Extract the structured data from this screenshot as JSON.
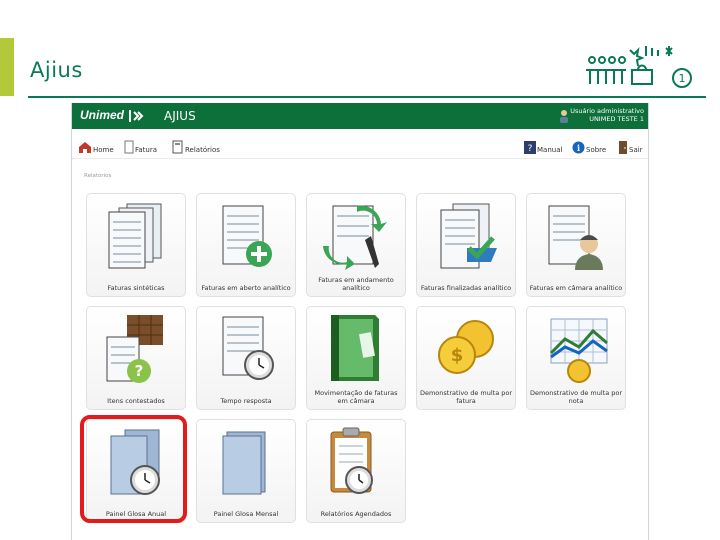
{
  "slide": {
    "title": "Ajius",
    "accent_color": "#b4c93a",
    "brand_color": "#0a7a52",
    "logo_icon": "unimed-people-logo",
    "logo_badge": "1"
  },
  "app": {
    "brand": "Unimed",
    "name": "AJIUS",
    "header_color": "#0d6f3a",
    "user_line1": "Usuário administrativo",
    "user_line2": "UNIMED TESTE 1",
    "toolbar": {
      "home": "Home",
      "fatura": "Fatura",
      "relatorios": "Relatórios",
      "manual": "Manual",
      "sobre": "Sobre",
      "sair": "Sair"
    },
    "breadcrumb": "Relatórios",
    "tiles": [
      {
        "label": "Faturas sintéticas",
        "icon": "documents-stack-icon"
      },
      {
        "label": "Faturas em aberto analítico",
        "icon": "document-add-icon"
      },
      {
        "label": "Faturas em andamento analítico",
        "icon": "document-edit-icon"
      },
      {
        "label": "Faturas finalizadas analítico",
        "icon": "documents-check-icon"
      },
      {
        "label": "Faturas em câmara analítico",
        "icon": "document-person-icon"
      },
      {
        "label": "Itens contestados",
        "icon": "box-question-icon"
      },
      {
        "label": "Tempo resposta",
        "icon": "document-clock-icon"
      },
      {
        "label": "Movimentação de faturas em câmara",
        "icon": "green-binder-icon"
      },
      {
        "label": "Demonstrativo de multa por fatura",
        "icon": "coins-icon"
      },
      {
        "label": "Demonstrativo de multa por nota",
        "icon": "chart-grid-icon"
      },
      {
        "label": "Painel Glosa Anual",
        "icon": "documents-clock-icon"
      },
      {
        "label": "Painel Glosa Mensal",
        "icon": "document-blue-icon"
      },
      {
        "label": "Relatórios Agendados",
        "icon": "clipboard-clock-icon"
      }
    ],
    "highlighted_tile": "Painel Glosa Anual",
    "highlight_color": "#e31b1b"
  }
}
